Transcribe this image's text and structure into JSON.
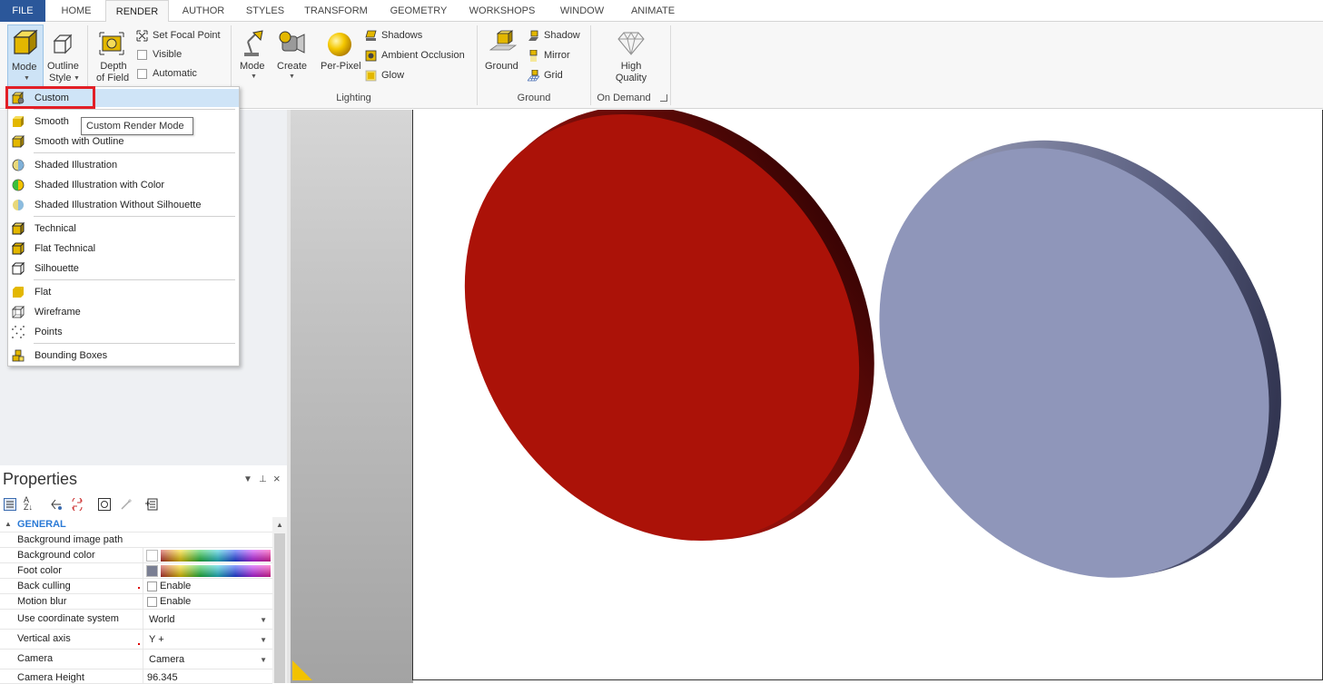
{
  "tabs": [
    "FILE",
    "HOME",
    "RENDER",
    "AUTHOR",
    "STYLES",
    "TRANSFORM",
    "GEOMETRY",
    "WORKSHOPS",
    "WINDOW",
    "ANIMATE"
  ],
  "ribbon": {
    "mode": "Mode",
    "outline_style_1": "Outline",
    "outline_style_2": "Style",
    "depth_1": "Depth",
    "depth_2": "of Field",
    "set_focal_point": "Set Focal Point",
    "visible": "Visible",
    "automatic": "Automatic",
    "light_mode": "Mode",
    "create": "Create",
    "per_pixel": "Per-Pixel",
    "shadows": "Shadows",
    "ambient_occlusion": "Ambient Occlusion",
    "glow": "Glow",
    "lighting_group": "Lighting",
    "ground": "Ground",
    "shadow": "Shadow",
    "mirror": "Mirror",
    "grid": "Grid",
    "ground_group": "Ground",
    "high_1": "High",
    "high_2": "Quality",
    "on_demand": "On Demand"
  },
  "menu": {
    "items": [
      {
        "label": "Custom",
        "icon": "custom-mode-icon"
      },
      {
        "label": "Smooth",
        "icon": "smooth-icon"
      },
      {
        "label": "Smooth with Outline",
        "icon": "smooth-outline-icon"
      },
      {
        "label": "Shaded Illustration",
        "icon": "shaded-illustration-icon"
      },
      {
        "label": "Shaded Illustration with Color",
        "icon": "shaded-color-icon"
      },
      {
        "label": "Shaded Illustration Without Silhouette",
        "icon": "shaded-no-silhouette-icon"
      },
      {
        "label": "Technical",
        "icon": "technical-icon"
      },
      {
        "label": "Flat Technical",
        "icon": "flat-technical-icon"
      },
      {
        "label": "Silhouette",
        "icon": "silhouette-icon"
      },
      {
        "label": "Flat",
        "icon": "flat-icon"
      },
      {
        "label": "Wireframe",
        "icon": "wireframe-icon"
      },
      {
        "label": "Points",
        "icon": "points-icon"
      },
      {
        "label": "Bounding Boxes",
        "icon": "bounding-boxes-icon"
      }
    ],
    "tooltip": "Custom Render Mode"
  },
  "properties": {
    "title": "Properties",
    "section": "GENERAL",
    "rows": {
      "bg_image": {
        "label": "Background image path"
      },
      "bg_color": {
        "label": "Background color",
        "swatch": "#ffffff"
      },
      "foot_color": {
        "label": "Foot color",
        "swatch": "#7a7f93"
      },
      "back_culling": {
        "label": "Back culling",
        "value": "Enable"
      },
      "motion_blur": {
        "label": "Motion blur",
        "value": "Enable"
      },
      "coord_system": {
        "label": "Use coordinate system",
        "value": "World"
      },
      "vertical_axis": {
        "label": "Vertical axis",
        "value": "Y +"
      },
      "camera": {
        "label": "Camera",
        "value": "Camera"
      },
      "camera_height": {
        "label": "Camera Height",
        "value": "96.345"
      }
    }
  },
  "colors": {
    "red_disc": "#ab1208",
    "blue_disc": "#8f96ba",
    "accent": "#2b579a",
    "highlight_box": "#e21f26"
  }
}
